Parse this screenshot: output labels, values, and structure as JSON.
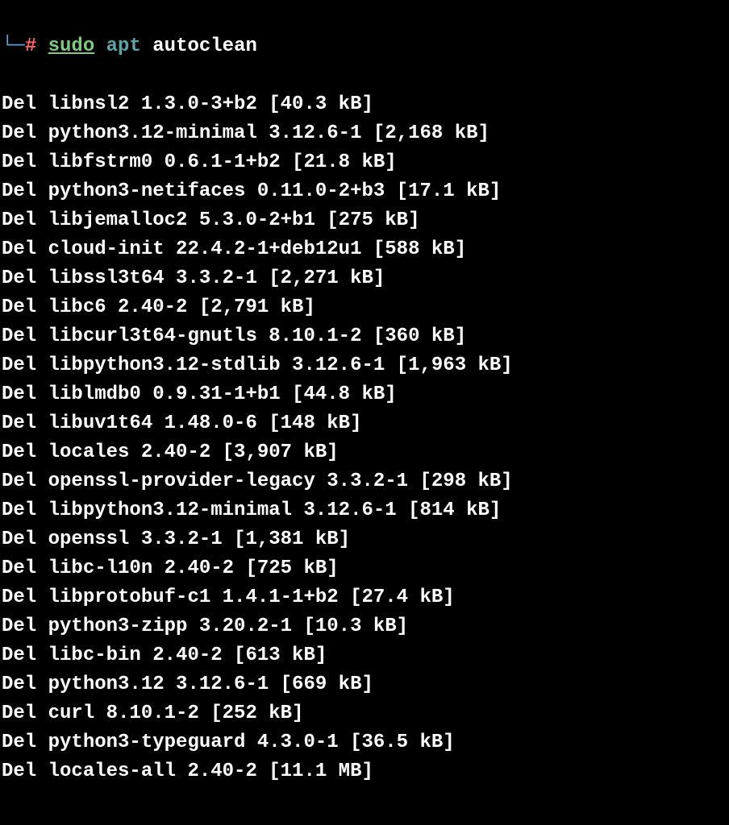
{
  "prompt": {
    "branch_symbol": "└─",
    "hash": "#",
    "sudo": "sudo",
    "apt": "apt",
    "command": "autoclean"
  },
  "output": [
    {
      "action": "Del",
      "package": "libnsl2",
      "version": "1.3.0-3+b2",
      "size": "40.3 kB"
    },
    {
      "action": "Del",
      "package": "python3.12-minimal",
      "version": "3.12.6-1",
      "size": "2,168 kB"
    },
    {
      "action": "Del",
      "package": "libfstrm0",
      "version": "0.6.1-1+b2",
      "size": "21.8 kB"
    },
    {
      "action": "Del",
      "package": "python3-netifaces",
      "version": "0.11.0-2+b3",
      "size": "17.1 kB"
    },
    {
      "action": "Del",
      "package": "libjemalloc2",
      "version": "5.3.0-2+b1",
      "size": "275 kB"
    },
    {
      "action": "Del",
      "package": "cloud-init",
      "version": "22.4.2-1+deb12u1",
      "size": "588 kB"
    },
    {
      "action": "Del",
      "package": "libssl3t64",
      "version": "3.3.2-1",
      "size": "2,271 kB"
    },
    {
      "action": "Del",
      "package": "libc6",
      "version": "2.40-2",
      "size": "2,791 kB"
    },
    {
      "action": "Del",
      "package": "libcurl3t64-gnutls",
      "version": "8.10.1-2",
      "size": "360 kB"
    },
    {
      "action": "Del",
      "package": "libpython3.12-stdlib",
      "version": "3.12.6-1",
      "size": "1,963 kB"
    },
    {
      "action": "Del",
      "package": "liblmdb0",
      "version": "0.9.31-1+b1",
      "size": "44.8 kB"
    },
    {
      "action": "Del",
      "package": "libuv1t64",
      "version": "1.48.0-6",
      "size": "148 kB"
    },
    {
      "action": "Del",
      "package": "locales",
      "version": "2.40-2",
      "size": "3,907 kB"
    },
    {
      "action": "Del",
      "package": "openssl-provider-legacy",
      "version": "3.3.2-1",
      "size": "298 kB"
    },
    {
      "action": "Del",
      "package": "libpython3.12-minimal",
      "version": "3.12.6-1",
      "size": "814 kB"
    },
    {
      "action": "Del",
      "package": "openssl",
      "version": "3.3.2-1",
      "size": "1,381 kB"
    },
    {
      "action": "Del",
      "package": "libc-l10n",
      "version": "2.40-2",
      "size": "725 kB"
    },
    {
      "action": "Del",
      "package": "libprotobuf-c1",
      "version": "1.4.1-1+b2",
      "size": "27.4 kB"
    },
    {
      "action": "Del",
      "package": "python3-zipp",
      "version": "3.20.2-1",
      "size": "10.3 kB"
    },
    {
      "action": "Del",
      "package": "libc-bin",
      "version": "2.40-2",
      "size": "613 kB"
    },
    {
      "action": "Del",
      "package": "python3.12",
      "version": "3.12.6-1",
      "size": "669 kB"
    },
    {
      "action": "Del",
      "package": "curl",
      "version": "8.10.1-2",
      "size": "252 kB"
    },
    {
      "action": "Del",
      "package": "python3-typeguard",
      "version": "4.3.0-1",
      "size": "36.5 kB"
    },
    {
      "action": "Del",
      "package": "locales-all",
      "version": "2.40-2",
      "size": "11.1 MB"
    }
  ]
}
